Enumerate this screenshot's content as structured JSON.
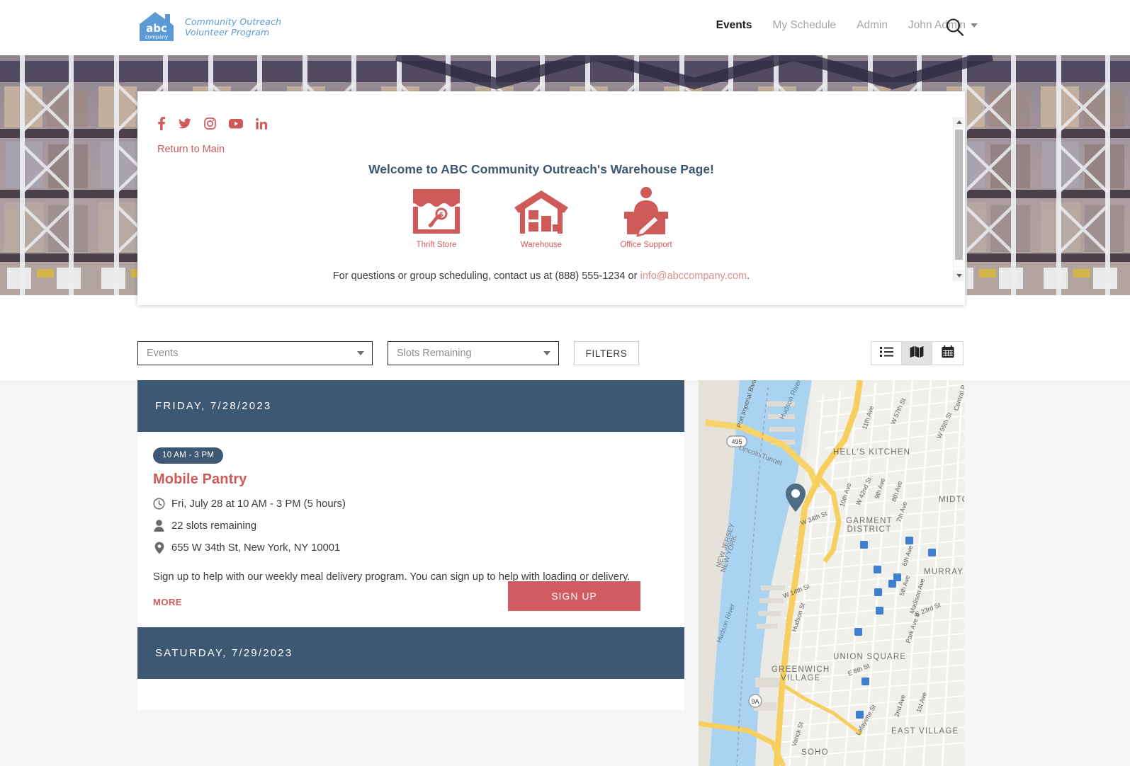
{
  "header": {
    "logo": {
      "brand": "abc",
      "brand_sub": "company",
      "tagline_line1": "Community Outreach",
      "tagline_line2": "Volunteer Program"
    },
    "nav": [
      {
        "label": "Events",
        "active": true
      },
      {
        "label": "My Schedule",
        "active": false
      },
      {
        "label": "Admin",
        "active": false
      },
      {
        "label": "John Admin",
        "active": false,
        "has_caret": true
      }
    ],
    "search_icon": "search-icon"
  },
  "panel": {
    "social": [
      "facebook-icon",
      "twitter-icon",
      "instagram-icon",
      "youtube-icon",
      "linkedin-icon"
    ],
    "return_link": "Return to Main",
    "welcome_title": "Welcome to ABC Community Outreach's Warehouse Page!",
    "categories": [
      {
        "label": "Thrift Store",
        "icon": "thrift-store-icon"
      },
      {
        "label": "Warehouse",
        "icon": "warehouse-icon"
      },
      {
        "label": "Office Support",
        "icon": "office-support-icon"
      }
    ],
    "contact_prefix": "For questions or group scheduling, contact us at (888) 555-1234 or ",
    "contact_email": "info@abccompany.com",
    "contact_suffix": "."
  },
  "filters": {
    "event_select": {
      "value": "Events"
    },
    "slots_select": {
      "value": "Slots Remaining"
    },
    "filters_button": "FILTERS",
    "views": [
      {
        "name": "list-view",
        "icon": "list-icon",
        "selected": false
      },
      {
        "name": "map-view",
        "icon": "map-icon",
        "selected": true
      },
      {
        "name": "calendar-view",
        "icon": "calendar-icon",
        "selected": false
      }
    ]
  },
  "events": {
    "days": [
      {
        "date_label": "FRIDAY, 7/28/2023",
        "items": [
          {
            "time_badge": "10 AM - 3 PM",
            "title": "Mobile Pantry",
            "datetime": "Fri, July 28 at 10 AM - 3 PM (5 hours)",
            "slots": "22 slots remaining",
            "address": "655 W 34th St, New York, NY 10001",
            "description": "Sign up to help with our weekly meal delivery program. You can sign up to help with loading or delivery.",
            "more_label": "MORE",
            "signup_label": "SIGN UP"
          }
        ]
      },
      {
        "date_label": "SATURDAY, 7/29/2023",
        "items": []
      }
    ]
  },
  "map": {
    "neighborhoods": [
      "HELL'S KITCHEN",
      "GARMENT DISTRICT",
      "MIDTO",
      "MURRAY",
      "UNION SQUARE",
      "GREENWICH VILLAGE",
      "EAST VILLAGE",
      "SOHO",
      "NEW JERSEY",
      "NEW YORK"
    ],
    "waters": [
      "Hudson River",
      "Hudson River"
    ],
    "roads": [
      "Lincoln Tunnel",
      "495",
      "9A",
      "W 57th St",
      "W 59th St",
      "W 42nd St",
      "W 34th St",
      "W 14th St",
      "E 23rd St",
      "E 8th St",
      "11th Ave",
      "10th Ave",
      "9th Ave",
      "8th Ave",
      "7th Ave",
      "6th Ave",
      "5th Ave",
      "Madison Ave",
      "Park Ave S",
      "2nd Ave",
      "1st Ave",
      "Hudson St",
      "Varick St",
      "Lafayette St",
      "Port Imperial Blvd",
      "Central P"
    ],
    "marker": "location-pin"
  },
  "colors": {
    "brand_red": "#cf5a5a",
    "navy": "#3d5873",
    "signup_red": "#d25a61",
    "logo_blue": "#5b9bd5"
  }
}
